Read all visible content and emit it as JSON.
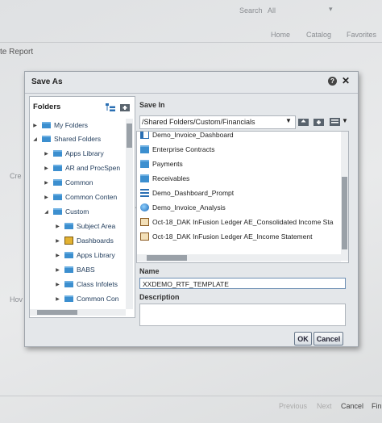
{
  "background": {
    "search_label": "Search",
    "search_scope": "All",
    "nav": [
      "Home",
      "Catalog",
      "Favorites"
    ],
    "page_title_fragment": "te Report",
    "side_fragment_1": "Cre",
    "side_fragment_2": "Hov",
    "footer_buttons": [
      "Previous",
      "Next",
      "Cancel",
      "Fin"
    ]
  },
  "dialog": {
    "title": "Save As",
    "help_icon": "question-circle-icon",
    "close_glyph": "✕",
    "folders_header": "Folders",
    "tree": [
      {
        "label": "My Folders",
        "level": 0,
        "expanded": false,
        "icon": "folder-icon"
      },
      {
        "label": "Shared Folders",
        "level": 0,
        "expanded": true,
        "icon": "folder-icon"
      },
      {
        "label": "Apps Library",
        "level": 1,
        "expanded": false,
        "icon": "folder-icon"
      },
      {
        "label": "AR and ProcSpen",
        "level": 1,
        "expanded": false,
        "icon": "folder-icon"
      },
      {
        "label": "Common",
        "level": 1,
        "expanded": false,
        "icon": "folder-icon"
      },
      {
        "label": "Common Conten",
        "level": 1,
        "expanded": false,
        "icon": "folder-icon"
      },
      {
        "label": "Custom",
        "level": 1,
        "expanded": true,
        "icon": "folder-icon"
      },
      {
        "label": "Subject Area",
        "level": 2,
        "expanded": false,
        "icon": "folder-icon"
      },
      {
        "label": "Dashboards",
        "level": 2,
        "expanded": false,
        "icon": "dashboard-folder-icon"
      },
      {
        "label": "Apps Library",
        "level": 2,
        "expanded": false,
        "icon": "folder-icon"
      },
      {
        "label": "BABS",
        "level": 2,
        "expanded": false,
        "icon": "folder-icon"
      },
      {
        "label": "Class Infolets",
        "level": 2,
        "expanded": false,
        "icon": "folder-icon"
      },
      {
        "label": "Common Con",
        "level": 2,
        "expanded": false,
        "icon": "folder-icon"
      }
    ],
    "save_in_label": "Save In",
    "save_in_path": "/Shared Folders/Custom/Financials",
    "files": [
      {
        "label": "Demo_Invoice_Dashboard",
        "icon": "dashboard-icon"
      },
      {
        "label": "Enterprise Contracts",
        "icon": "folder-icon"
      },
      {
        "label": "Payments",
        "icon": "folder-icon"
      },
      {
        "label": "Receivables",
        "icon": "folder-icon"
      },
      {
        "label": "Demo_Dashboard_Prompt",
        "icon": "prompt-icon"
      },
      {
        "label": "Demo_Invoice_Analysis",
        "icon": "analysis-icon"
      },
      {
        "label": "Oct-18_DAK InFusion Ledger AE_Consolidated Income Sta",
        "icon": "report-icon"
      },
      {
        "label": "Oct-18_DAK InFusion Ledger AE_Income Statement",
        "icon": "report-icon"
      }
    ],
    "name_label": "Name",
    "name_value": "XXDEMO_RTF_TEMPLATE",
    "description_label": "Description",
    "description_value": "",
    "ok_label": "OK",
    "cancel_label": "Cancel"
  }
}
